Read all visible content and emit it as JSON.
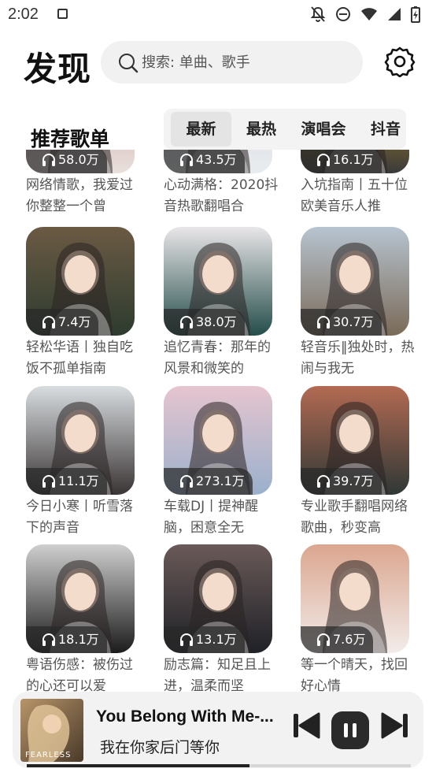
{
  "status_bar": {
    "time": "2:02"
  },
  "header": {
    "title": "发现",
    "search_placeholder": "搜索: 单曲、歌手"
  },
  "section": {
    "title": "推荐歌单",
    "tabs": [
      {
        "label": "最新",
        "active": true
      },
      {
        "label": "最热",
        "active": false
      },
      {
        "label": "演唱会",
        "active": false
      },
      {
        "label": "抖音",
        "active": false
      }
    ]
  },
  "playlists": [
    {
      "count": "58.0万",
      "title": "网络情歌，我爱过你整整一个曾",
      "colors": [
        "#c99",
        "#e8e0dc"
      ]
    },
    {
      "count": "43.5万",
      "title": "心动满格：2020抖音热歌翻唱合",
      "colors": [
        "#cfd4da",
        "#e9ecef"
      ]
    },
    {
      "count": "16.1万",
      "title": "入坑指南丨五十位欧美音乐人推",
      "colors": [
        "#d9a423",
        "#3a3a3a"
      ]
    },
    {
      "count": "7.4万",
      "title": "轻松华语丨独自吃饭不孤单指南",
      "colors": [
        "#6b5a44",
        "#2d3b2f"
      ]
    },
    {
      "count": "38.0万",
      "title": "追忆青春：那年的风景和微笑的",
      "colors": [
        "#e9e6e8",
        "#244d4a"
      ]
    },
    {
      "count": "30.7万",
      "title": "轻音乐‖独处时，热闹与我无",
      "colors": [
        "#b7c4d0",
        "#7a6a58"
      ]
    },
    {
      "count": "11.1万",
      "title": "今日小寒丨听雪落下的声音",
      "colors": [
        "#d8dde0",
        "#3a3434"
      ]
    },
    {
      "count": "273.1万",
      "title": "车载DJ丨提神醒脑，困意全无",
      "colors": [
        "#e6c5cf",
        "#9ab0cc"
      ]
    },
    {
      "count": "39.7万",
      "title": "专业歌手翻唱网络歌曲，秒变高",
      "colors": [
        "#b36a52",
        "#2f3836"
      ]
    },
    {
      "count": "18.1万",
      "title": "粤语伤感：被伤过的心还可以爱",
      "colors": [
        "#cfcfcf",
        "#1c1c1c"
      ]
    },
    {
      "count": "13.1万",
      "title": "励志篇：知足且上进，温柔而坚",
      "colors": [
        "#6a5a58",
        "#1f2127"
      ]
    },
    {
      "count": "7.6万",
      "title": "等一个晴天，找回好心情",
      "colors": [
        "#dba68f",
        "#f2ecea"
      ]
    }
  ],
  "player": {
    "song": "You Belong With Me-...",
    "artist": "我在你家后门等你",
    "album_text": "FEARLESS",
    "progress": 0.58
  }
}
